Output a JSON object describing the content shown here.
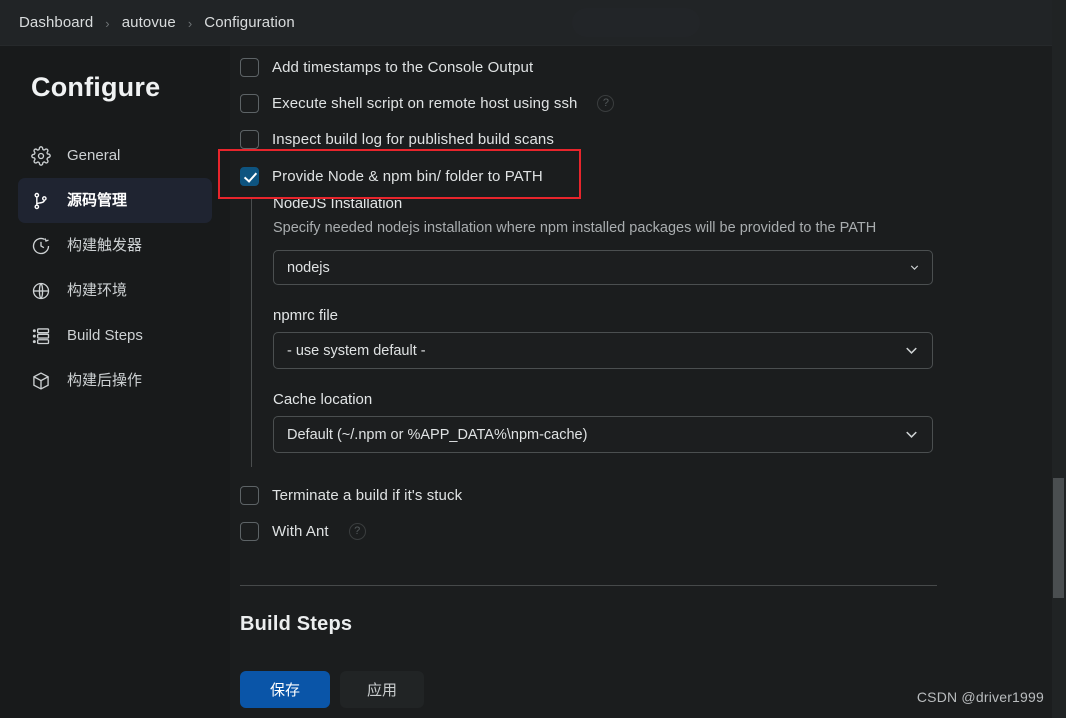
{
  "header": {
    "breadcrumb": [
      {
        "label": "Dashboard",
        "icon": ""
      },
      {
        "label": "autovue",
        "icon": ""
      },
      {
        "label": "Configuration",
        "icon": ""
      }
    ],
    "separator": "›"
  },
  "sidebar": {
    "title": "Configure",
    "items": [
      {
        "label": "General",
        "icon": "gear-icon",
        "selected": false
      },
      {
        "label": "源码管理",
        "icon": "git-branch-icon",
        "selected": true
      },
      {
        "label": "构建触发器",
        "icon": "clock-icon",
        "selected": false
      },
      {
        "label": "构建环境",
        "icon": "globe-icon",
        "selected": false
      },
      {
        "label": "Build Steps",
        "icon": "list-icon",
        "selected": false
      },
      {
        "label": "构建后操作",
        "icon": "package-icon",
        "selected": false
      }
    ]
  },
  "main": {
    "options": [
      {
        "label": "Add timestamps to the Console Output",
        "checked": false,
        "help": false
      },
      {
        "label": "Execute shell script on remote host using ssh",
        "checked": false,
        "help": true
      },
      {
        "label": "Inspect build log for published build scans",
        "checked": false,
        "help": false
      },
      {
        "label": "Provide Node & npm bin/ folder to PATH",
        "checked": true,
        "help": false
      }
    ],
    "nodejs": {
      "title": "NodeJS Installation",
      "description": "Specify needed nodejs installation where npm installed packages will be provided to the PATH",
      "installation_value": "nodejs",
      "npmrc_label": "npmrc file",
      "npmrc_value": "- use system default -",
      "cache_label": "Cache location",
      "cache_value": "Default (~/.npm or %APP_DATA%\\npm-cache)"
    },
    "options_after": [
      {
        "label": "Terminate a build if it's stuck",
        "checked": false,
        "help": false
      },
      {
        "label": "With Ant",
        "checked": false,
        "help": true
      }
    ],
    "build_steps_title": "Build Steps",
    "help_glyph": "?"
  },
  "footer": {
    "save_label": "保存",
    "apply_label": "应用"
  },
  "watermark": "CSDN @driver1999",
  "colors": {
    "accent_blue": "#0a55a8",
    "checkbox_checked": "#0e5480",
    "annotation_red": "#e8252c",
    "sidebar_selected": "#1f2431",
    "page_bg": "#1b1d1e"
  }
}
